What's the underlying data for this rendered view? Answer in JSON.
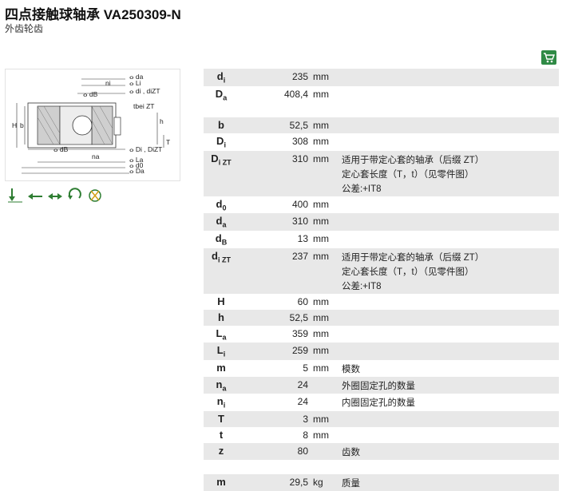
{
  "header": {
    "title": "四点接触球轴承 VA250309-N",
    "subtitle": "外齿轮齿"
  },
  "drawing_labels": {
    "dimension_diagram": [
      "ⴰ da",
      "ⴰ Li",
      "ⴰ di , diZT",
      "ⴰ dB",
      "ni",
      "tbei ZT",
      "H",
      "b",
      "h",
      "T",
      "ⴰ dB",
      "na",
      "ⴰ Di , DiZT",
      "ⴰ La",
      "ⴰ d0",
      "ⴰ Da"
    ]
  },
  "load_icons": [
    "axial-load-icon",
    "radial-load-icon",
    "radial-load-both-icon",
    "moment-load-icon",
    "rotation-icon"
  ],
  "specs": [
    {
      "sym": "d",
      "sub": "i",
      "value": "235",
      "unit": "mm",
      "desc": []
    },
    {
      "sym": "D",
      "sub": "a",
      "value": "408,4",
      "unit": "mm",
      "desc": []
    },
    {
      "spacer": true
    },
    {
      "sym": "b",
      "sub": "",
      "value": "52,5",
      "unit": "mm",
      "desc": []
    },
    {
      "sym": "D",
      "sub": "i",
      "value": "308",
      "unit": "mm",
      "desc": []
    },
    {
      "sym": "D",
      "sub": "i ZT",
      "value": "310",
      "unit": "mm",
      "desc": [
        "适用于带定心套的轴承（后缀 ZT）",
        "定心套长度（T，t）（见零件图）",
        "公差:+IT8"
      ]
    },
    {
      "sym": "d",
      "sub": "0",
      "value": "400",
      "unit": "mm",
      "desc": []
    },
    {
      "sym": "d",
      "sub": "a",
      "value": "310",
      "unit": "mm",
      "desc": []
    },
    {
      "sym": "d",
      "sub": "B",
      "value": "13",
      "unit": "mm",
      "desc": []
    },
    {
      "sym": "d",
      "sub": "i ZT",
      "value": "237",
      "unit": "mm",
      "desc": [
        "适用于带定心套的轴承（后缀 ZT）",
        "定心套长度（T，t）（见零件图）",
        "公差:+IT8"
      ]
    },
    {
      "sym": "H",
      "sub": "",
      "value": "60",
      "unit": "mm",
      "desc": []
    },
    {
      "sym": "h",
      "sub": "",
      "value": "52,5",
      "unit": "mm",
      "desc": []
    },
    {
      "sym": "L",
      "sub": "a",
      "value": "359",
      "unit": "mm",
      "desc": []
    },
    {
      "sym": "L",
      "sub": "i",
      "value": "259",
      "unit": "mm",
      "desc": []
    },
    {
      "sym": "m",
      "sub": "",
      "value": "5",
      "unit": "mm",
      "desc": [
        "模数"
      ]
    },
    {
      "sym": "n",
      "sub": "a",
      "value": "24",
      "unit": "",
      "desc": [
        "外圈固定孔的数量"
      ]
    },
    {
      "sym": "n",
      "sub": "i",
      "value": "24",
      "unit": "",
      "desc": [
        "内圈固定孔的数量"
      ]
    },
    {
      "sym": "T",
      "sub": "",
      "value": "3",
      "unit": "mm",
      "desc": []
    },
    {
      "sym": "t",
      "sub": "",
      "value": "8",
      "unit": "mm",
      "desc": []
    },
    {
      "sym": "z",
      "sub": "",
      "value": "80",
      "unit": "",
      "desc": [
        "齿数"
      ]
    },
    {
      "spacer": true
    },
    {
      "sym": "m",
      "sub": "",
      "value": "29,5",
      "unit": "kg",
      "desc": [
        "质量"
      ]
    }
  ]
}
